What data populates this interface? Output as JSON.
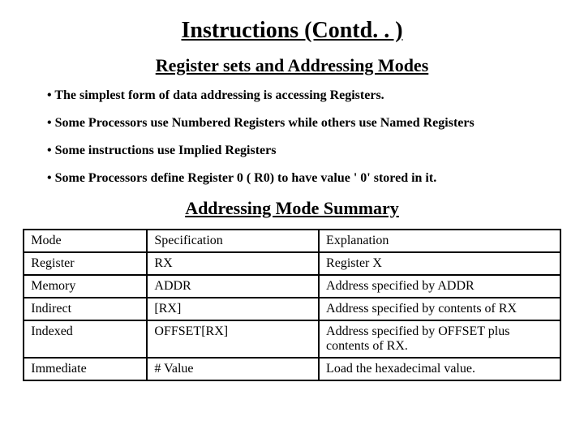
{
  "title": "Instructions (Contd. . )",
  "subtitle": "Register sets and Addressing Modes",
  "bullets": [
    "• The simplest form of data addressing is accessing Registers.",
    "• Some Processors use Numbered Registers while others use Named Registers",
    "• Some instructions use Implied Registers",
    "• Some Processors define Register 0 ( R0) to have value ' 0' stored in it."
  ],
  "section_heading": "Addressing Mode Summary",
  "table": {
    "headers": [
      "Mode",
      "Specification",
      "Explanation"
    ],
    "rows": [
      [
        "Register",
        "RX",
        "Register X"
      ],
      [
        "Memory",
        "ADDR",
        "Address specified by ADDR"
      ],
      [
        "Indirect",
        "[RX]",
        "Address specified by contents of RX"
      ],
      [
        "Indexed",
        "OFFSET[RX]",
        "Address specified by OFFSET plus contents of RX."
      ],
      [
        "Immediate",
        "# Value",
        "Load the hexadecimal value."
      ]
    ]
  }
}
